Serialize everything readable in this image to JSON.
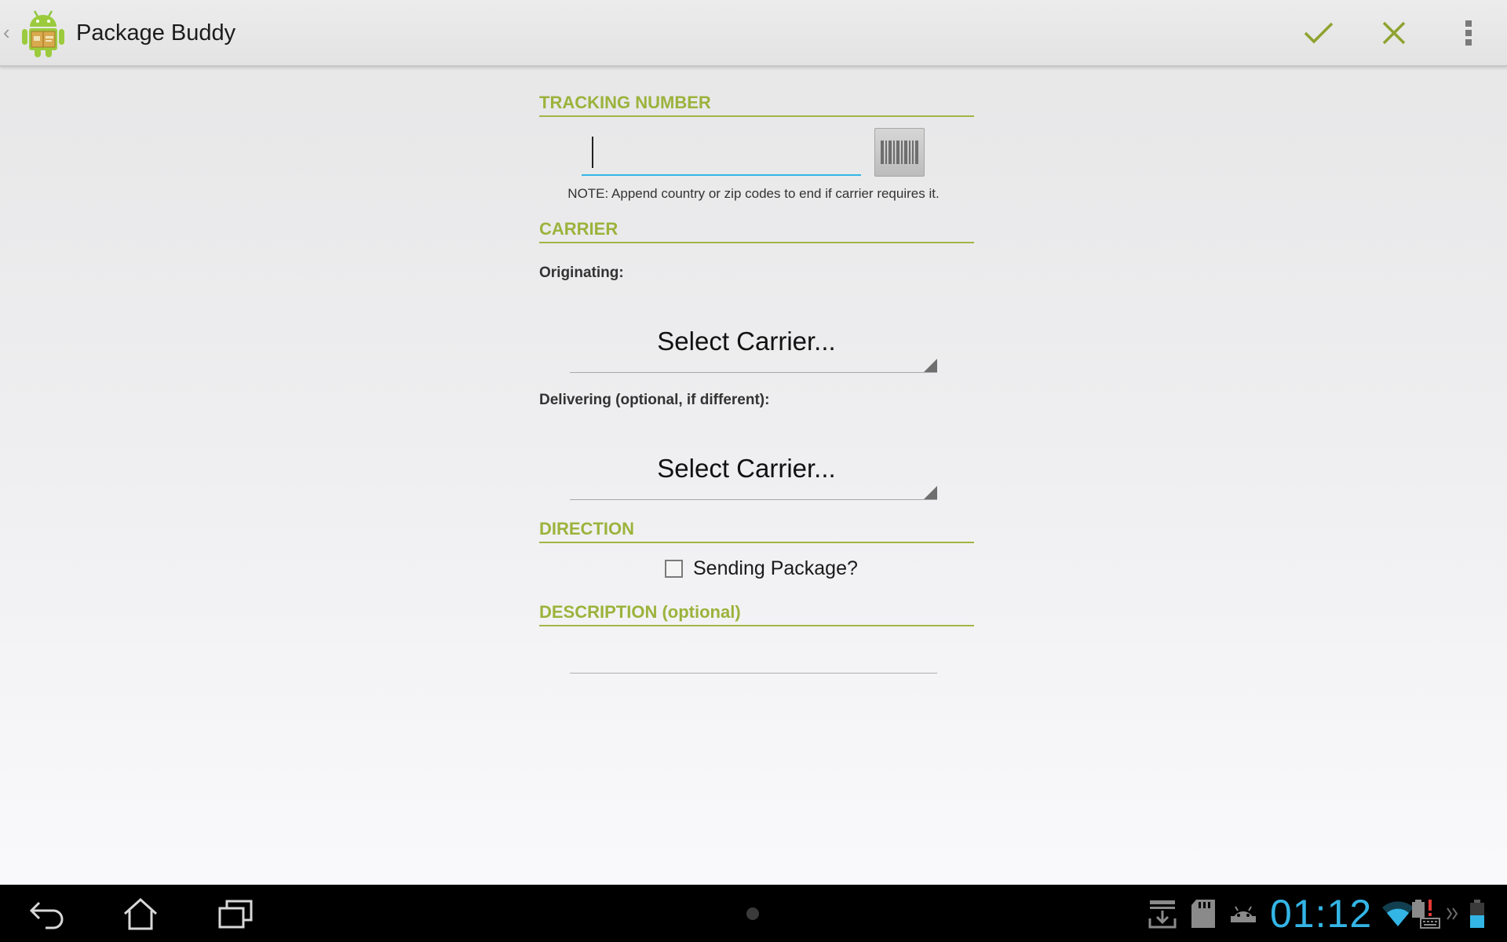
{
  "app": {
    "title": "Package Buddy"
  },
  "actionbar": {
    "accept_icon": "checkmark-icon",
    "cancel_icon": "close-icon",
    "overflow_icon": "overflow-menu-icon",
    "accent_color": "#8ea32f"
  },
  "tracking": {
    "header": "TRACKING NUMBER",
    "value": "",
    "scan_icon": "barcode-icon",
    "note": "NOTE: Append country or zip codes to end if carrier requires it."
  },
  "carrier": {
    "header": "CARRIER",
    "originating_label": "Originating:",
    "originating_value": "Select Carrier...",
    "delivering_label": "Delivering (optional, if different):",
    "delivering_value": "Select Carrier..."
  },
  "direction": {
    "header": "DIRECTION",
    "checkbox_label": "Sending Package?",
    "checked": false
  },
  "description": {
    "header": "DESCRIPTION (optional)",
    "value": ""
  },
  "system_bar": {
    "clock": "01:12",
    "clock_color": "#33b5e5",
    "nav": [
      "back-icon",
      "home-icon",
      "recent-apps-icon"
    ],
    "status_icons": [
      "download-icon",
      "sd-card-icon",
      "android-debug-icon",
      "wifi-icon",
      "keyboard-alert-icon",
      "expand-icon",
      "battery-icon"
    ]
  }
}
